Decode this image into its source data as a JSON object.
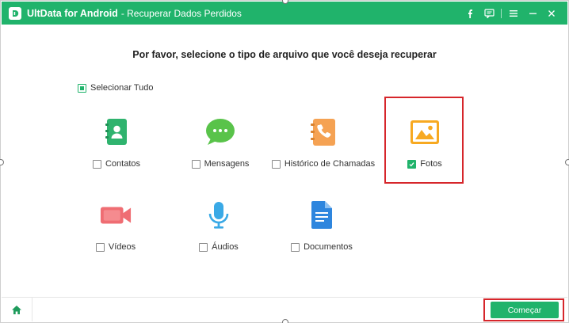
{
  "window": {
    "app_name": "UltData for Android",
    "subtitle": "- Recuperar Dados Perdidos",
    "accent": "#20b36b"
  },
  "titlebar_icons": [
    "facebook-icon",
    "feedback-icon",
    "menu-icon",
    "minimize-icon",
    "close-icon"
  ],
  "main": {
    "heading": "Por favor, selecione o tipo de arquivo que você deseja recuperar",
    "select_all": {
      "label": "Selecionar Tudo",
      "state": "partial"
    },
    "file_types": [
      {
        "label": "Contatos",
        "checked": false,
        "icon": "contacts-icon"
      },
      {
        "label": "Mensagens",
        "checked": false,
        "icon": "messages-icon"
      },
      {
        "label": "Histórico de Chamadas",
        "checked": false,
        "icon": "call-history-icon"
      },
      {
        "label": "Fotos",
        "checked": true,
        "icon": "photos-icon",
        "highlighted": true
      },
      {
        "label": "Vídeos",
        "checked": false,
        "icon": "videos-icon"
      },
      {
        "label": "Áudios",
        "checked": false,
        "icon": "audios-icon"
      },
      {
        "label": "Documentos",
        "checked": false,
        "icon": "documents-icon"
      }
    ]
  },
  "footer": {
    "start_label": "Começar",
    "highlight_color": "#d6262b"
  }
}
